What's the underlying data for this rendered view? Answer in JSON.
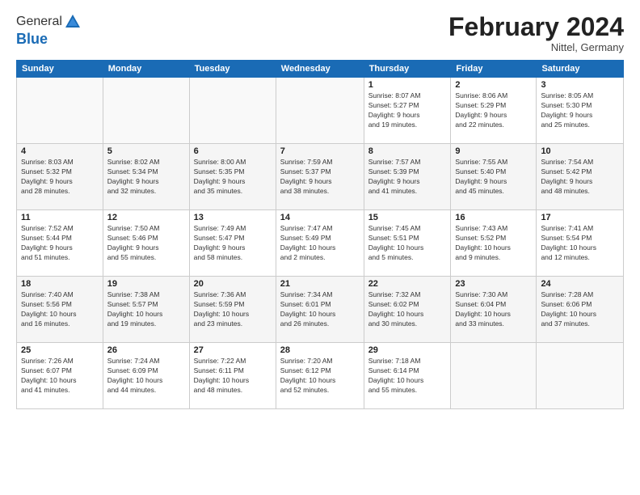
{
  "logo": {
    "general": "General",
    "blue": "Blue"
  },
  "title": "February 2024",
  "location": "Nittel, Germany",
  "days_of_week": [
    "Sunday",
    "Monday",
    "Tuesday",
    "Wednesday",
    "Thursday",
    "Friday",
    "Saturday"
  ],
  "weeks": [
    [
      {
        "day": "",
        "info": ""
      },
      {
        "day": "",
        "info": ""
      },
      {
        "day": "",
        "info": ""
      },
      {
        "day": "",
        "info": ""
      },
      {
        "day": "1",
        "info": "Sunrise: 8:07 AM\nSunset: 5:27 PM\nDaylight: 9 hours\nand 19 minutes."
      },
      {
        "day": "2",
        "info": "Sunrise: 8:06 AM\nSunset: 5:29 PM\nDaylight: 9 hours\nand 22 minutes."
      },
      {
        "day": "3",
        "info": "Sunrise: 8:05 AM\nSunset: 5:30 PM\nDaylight: 9 hours\nand 25 minutes."
      }
    ],
    [
      {
        "day": "4",
        "info": "Sunrise: 8:03 AM\nSunset: 5:32 PM\nDaylight: 9 hours\nand 28 minutes."
      },
      {
        "day": "5",
        "info": "Sunrise: 8:02 AM\nSunset: 5:34 PM\nDaylight: 9 hours\nand 32 minutes."
      },
      {
        "day": "6",
        "info": "Sunrise: 8:00 AM\nSunset: 5:35 PM\nDaylight: 9 hours\nand 35 minutes."
      },
      {
        "day": "7",
        "info": "Sunrise: 7:59 AM\nSunset: 5:37 PM\nDaylight: 9 hours\nand 38 minutes."
      },
      {
        "day": "8",
        "info": "Sunrise: 7:57 AM\nSunset: 5:39 PM\nDaylight: 9 hours\nand 41 minutes."
      },
      {
        "day": "9",
        "info": "Sunrise: 7:55 AM\nSunset: 5:40 PM\nDaylight: 9 hours\nand 45 minutes."
      },
      {
        "day": "10",
        "info": "Sunrise: 7:54 AM\nSunset: 5:42 PM\nDaylight: 9 hours\nand 48 minutes."
      }
    ],
    [
      {
        "day": "11",
        "info": "Sunrise: 7:52 AM\nSunset: 5:44 PM\nDaylight: 9 hours\nand 51 minutes."
      },
      {
        "day": "12",
        "info": "Sunrise: 7:50 AM\nSunset: 5:46 PM\nDaylight: 9 hours\nand 55 minutes."
      },
      {
        "day": "13",
        "info": "Sunrise: 7:49 AM\nSunset: 5:47 PM\nDaylight: 9 hours\nand 58 minutes."
      },
      {
        "day": "14",
        "info": "Sunrise: 7:47 AM\nSunset: 5:49 PM\nDaylight: 10 hours\nand 2 minutes."
      },
      {
        "day": "15",
        "info": "Sunrise: 7:45 AM\nSunset: 5:51 PM\nDaylight: 10 hours\nand 5 minutes."
      },
      {
        "day": "16",
        "info": "Sunrise: 7:43 AM\nSunset: 5:52 PM\nDaylight: 10 hours\nand 9 minutes."
      },
      {
        "day": "17",
        "info": "Sunrise: 7:41 AM\nSunset: 5:54 PM\nDaylight: 10 hours\nand 12 minutes."
      }
    ],
    [
      {
        "day": "18",
        "info": "Sunrise: 7:40 AM\nSunset: 5:56 PM\nDaylight: 10 hours\nand 16 minutes."
      },
      {
        "day": "19",
        "info": "Sunrise: 7:38 AM\nSunset: 5:57 PM\nDaylight: 10 hours\nand 19 minutes."
      },
      {
        "day": "20",
        "info": "Sunrise: 7:36 AM\nSunset: 5:59 PM\nDaylight: 10 hours\nand 23 minutes."
      },
      {
        "day": "21",
        "info": "Sunrise: 7:34 AM\nSunset: 6:01 PM\nDaylight: 10 hours\nand 26 minutes."
      },
      {
        "day": "22",
        "info": "Sunrise: 7:32 AM\nSunset: 6:02 PM\nDaylight: 10 hours\nand 30 minutes."
      },
      {
        "day": "23",
        "info": "Sunrise: 7:30 AM\nSunset: 6:04 PM\nDaylight: 10 hours\nand 33 minutes."
      },
      {
        "day": "24",
        "info": "Sunrise: 7:28 AM\nSunset: 6:06 PM\nDaylight: 10 hours\nand 37 minutes."
      }
    ],
    [
      {
        "day": "25",
        "info": "Sunrise: 7:26 AM\nSunset: 6:07 PM\nDaylight: 10 hours\nand 41 minutes."
      },
      {
        "day": "26",
        "info": "Sunrise: 7:24 AM\nSunset: 6:09 PM\nDaylight: 10 hours\nand 44 minutes."
      },
      {
        "day": "27",
        "info": "Sunrise: 7:22 AM\nSunset: 6:11 PM\nDaylight: 10 hours\nand 48 minutes."
      },
      {
        "day": "28",
        "info": "Sunrise: 7:20 AM\nSunset: 6:12 PM\nDaylight: 10 hours\nand 52 minutes."
      },
      {
        "day": "29",
        "info": "Sunrise: 7:18 AM\nSunset: 6:14 PM\nDaylight: 10 hours\nand 55 minutes."
      },
      {
        "day": "",
        "info": ""
      },
      {
        "day": "",
        "info": ""
      }
    ]
  ]
}
